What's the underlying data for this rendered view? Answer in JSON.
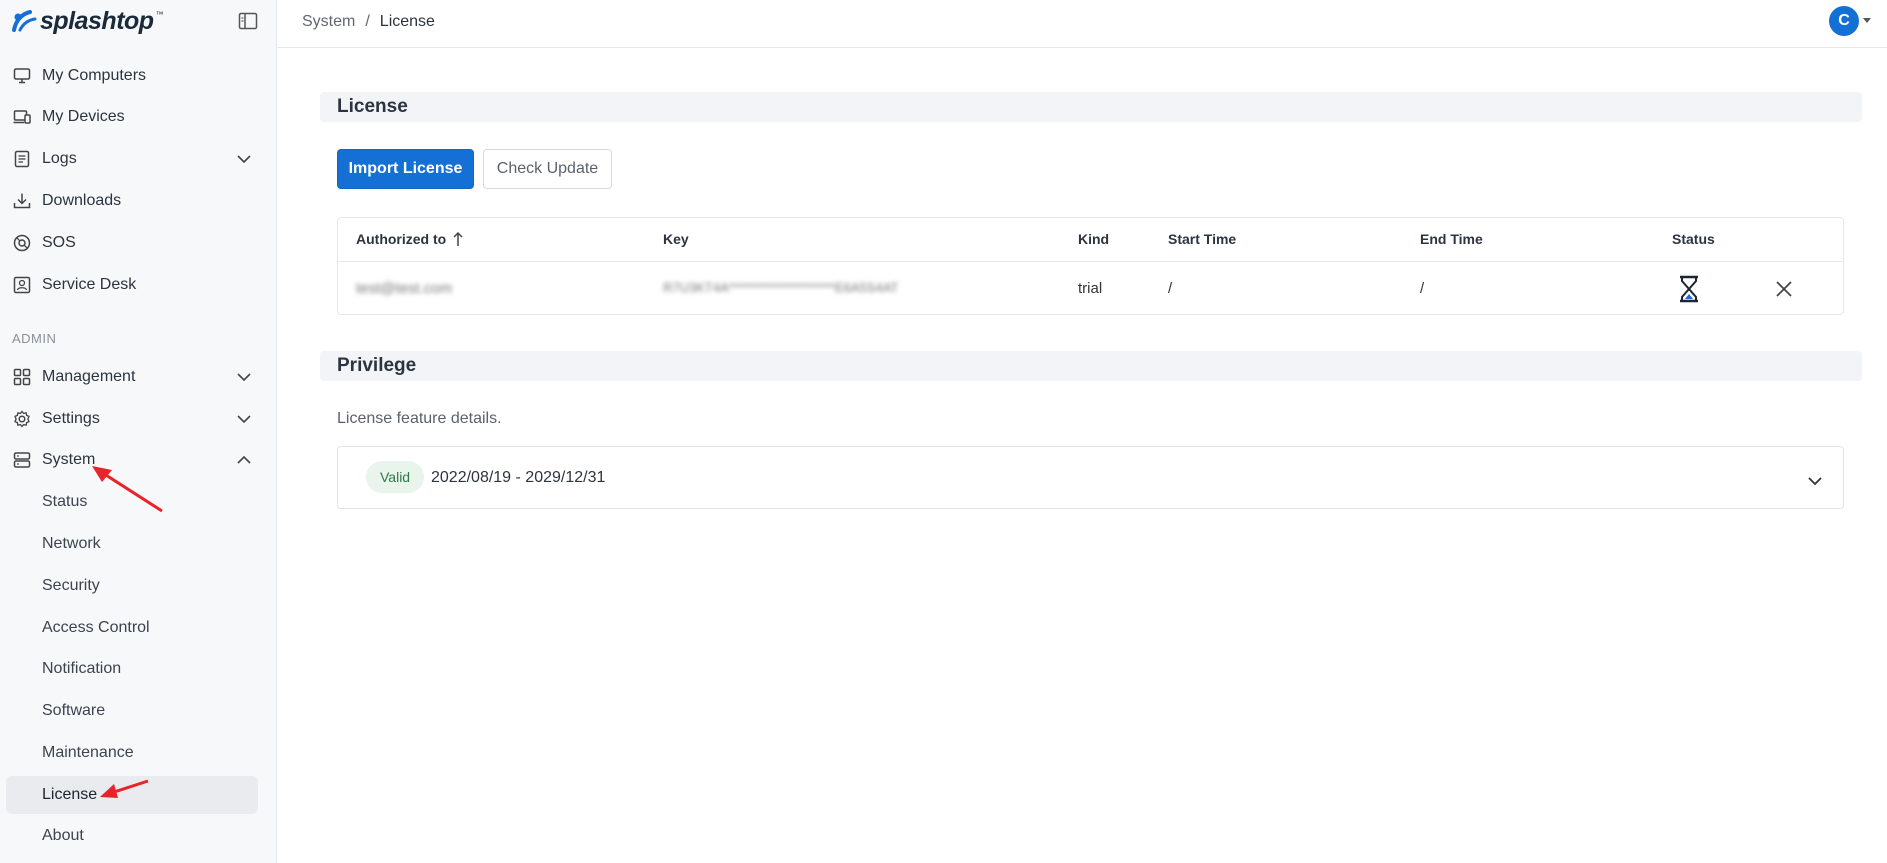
{
  "app": {
    "brand": "splashtop",
    "brand_mark": "™"
  },
  "sidebar": {
    "items": [
      {
        "label": "My Computers",
        "icon": "monitor-icon"
      },
      {
        "label": "My Devices",
        "icon": "devices-icon"
      },
      {
        "label": "Logs",
        "icon": "logs-icon"
      },
      {
        "label": "Downloads",
        "icon": "download-icon"
      },
      {
        "label": "SOS",
        "icon": "sos-icon"
      },
      {
        "label": "Service Desk",
        "icon": "service-desk-icon"
      }
    ],
    "section_admin": "ADMIN",
    "admin_items": [
      {
        "label": "Management",
        "icon": "grid-icon"
      },
      {
        "label": "Settings",
        "icon": "gear-icon"
      },
      {
        "label": "System",
        "icon": "server-icon"
      }
    ],
    "system_children": [
      "Status",
      "Network",
      "Security",
      "Access Control",
      "Notification",
      "Software",
      "Maintenance",
      "License",
      "About"
    ]
  },
  "header": {
    "breadcrumb_parent": "System",
    "breadcrumb_sep": "/",
    "breadcrumb_current": "License",
    "avatar_initial": "C"
  },
  "license": {
    "title": "License",
    "import_button": "Import License",
    "check_button": "Check Update",
    "columns": [
      "Authorized to",
      "Key",
      "Kind",
      "Start Time",
      "End Time",
      "Status"
    ],
    "row": {
      "authorized_to": "test@test.com",
      "key": "R7U3KT4A*********************E6A5S4AT",
      "kind": "trial",
      "start_time": "/",
      "end_time": "/",
      "status_icon": "hourglass-icon"
    }
  },
  "privilege": {
    "title": "Privilege",
    "description": "License feature details.",
    "badge": "Valid",
    "range": "2022/08/19 - 2029/12/31"
  },
  "colors": {
    "primary": "#1570d6",
    "valid_bg": "#e8f4ec",
    "valid_text": "#2f7a45"
  }
}
